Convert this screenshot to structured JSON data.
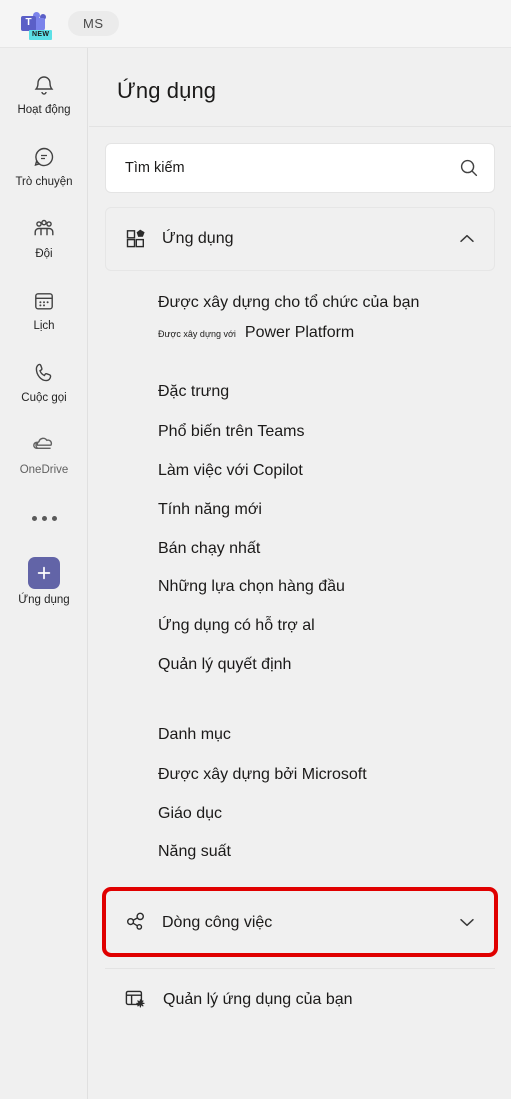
{
  "titlebar": {
    "app_logo_letter": "T",
    "new_badge": "NEW",
    "avatar_initials": "MS"
  },
  "rail": {
    "items": [
      {
        "label": "Hoạt động",
        "icon": "bell-icon"
      },
      {
        "label": "Trò chuyện",
        "icon": "chat-icon"
      },
      {
        "label": "Đội",
        "icon": "people-team-icon"
      },
      {
        "label": "Lịch",
        "icon": "calendar-icon"
      },
      {
        "label": "Cuộc gọi",
        "icon": "phone-icon"
      },
      {
        "label": "OneDrive",
        "icon": "cloud-icon"
      }
    ],
    "more_label": "",
    "apps": {
      "label": "Ứng dụng",
      "icon": "plus-icon"
    }
  },
  "main": {
    "page_title": "Ứng dụng",
    "search": {
      "value": "",
      "placeholder": "Tìm kiếm",
      "icon": "search-icon"
    },
    "apps_section": {
      "label": "Ứng dụng",
      "icon": "apps-grid-icon",
      "chevron": "chevron-up-icon",
      "expanded": true
    },
    "org_heading": "Được xây dựng cho tổ chức của bạn",
    "power_platform": {
      "prefix": "Được xây dựng với",
      "name": "Power Platform"
    },
    "featured": {
      "heading": "Đặc trưng",
      "links": [
        "Phổ biến trên Teams",
        "Làm việc với Copilot",
        "Tính năng mới",
        "Bán chạy nhất",
        "Những lựa chọn hàng đầu",
        "Ứng dụng có hỗ trợ al",
        "Quản lý quyết định"
      ]
    },
    "categories": {
      "heading": "Danh mục",
      "links": [
        "Được xây dựng bởi Microsoft",
        "Giáo dục",
        "Năng suất"
      ]
    },
    "workflow_section": {
      "label": "Dòng công việc",
      "icon": "share-nodes-icon",
      "chevron": "chevron-down-icon",
      "expanded": false,
      "highlight_color": "#e00000"
    },
    "manage_apps": {
      "label": "Quản lý ứng dụng của bạn",
      "icon": "app-settings-icon"
    }
  },
  "colors": {
    "accent_purple": "#6264a7",
    "teams_blue": "#5b5fc7",
    "badge_cyan": "#5ce0e6",
    "highlight_red": "#e00000",
    "background": "#f0f0f0"
  }
}
